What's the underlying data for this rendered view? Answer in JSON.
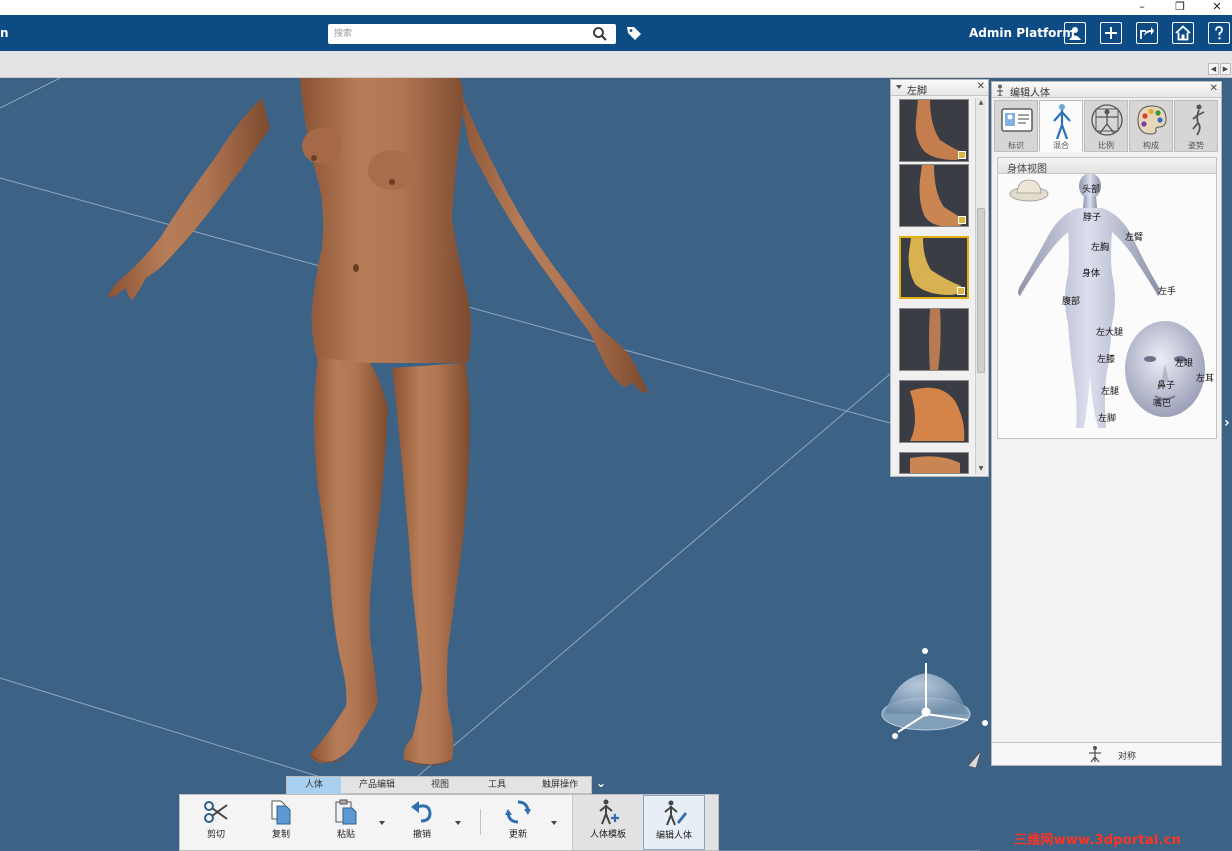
{
  "window": {
    "minimize": "–",
    "restore": "❐",
    "close": "✕"
  },
  "appbar": {
    "app_name": "n",
    "search_placeholder": "搜索",
    "admin_label": "Admin Platform"
  },
  "foot_panel": {
    "title": "左脚",
    "close": "✕",
    "selected_index": 2,
    "thumbnail_count": 6
  },
  "edit_panel": {
    "title": "编辑人体",
    "close": "✕",
    "tabs": [
      {
        "label": "标识",
        "icon": "id-card-icon"
      },
      {
        "label": "混合",
        "icon": "body-figure-icon"
      },
      {
        "label": "比例",
        "icon": "proportion-icon"
      },
      {
        "label": "构成",
        "icon": "palette-icon"
      },
      {
        "label": "姿势",
        "icon": "pose-icon"
      }
    ],
    "active_tab": "混合",
    "body_view_title": "身体视图",
    "body_parts": {
      "head": "头部",
      "neck": "脖子",
      "left_arm": "左臂",
      "left_chest": "左胸",
      "body": "身体",
      "left_hand": "左手",
      "abdomen": "腹部",
      "left_thigh": "左大腿",
      "left_knee": "左膝",
      "left_leg": "左腿",
      "left_foot": "左脚",
      "left_eye": "左眼",
      "left_ear": "左耳",
      "nose": "鼻子",
      "mouth": "嘴巴"
    },
    "symmetry_label": "对称"
  },
  "ribbon": {
    "tabs": [
      "人体",
      "产品编辑",
      "视图",
      "工具",
      "触屏操作"
    ],
    "active_tab": "人体",
    "buttons": {
      "cut": "剪切",
      "copy": "复制",
      "paste": "粘贴",
      "undo": "撤销",
      "update": "更新",
      "body_template": "人体模板",
      "edit_body": "编辑人体"
    }
  },
  "watermark": "三维网www.3dportal.cn",
  "colors": {
    "app_bar": "#0c4b84",
    "viewport": "#3c6286",
    "skin": "#b27956",
    "selection": "#e1b017",
    "ribbon_active": "#a9d0ef",
    "watermark": "#ff3322"
  }
}
